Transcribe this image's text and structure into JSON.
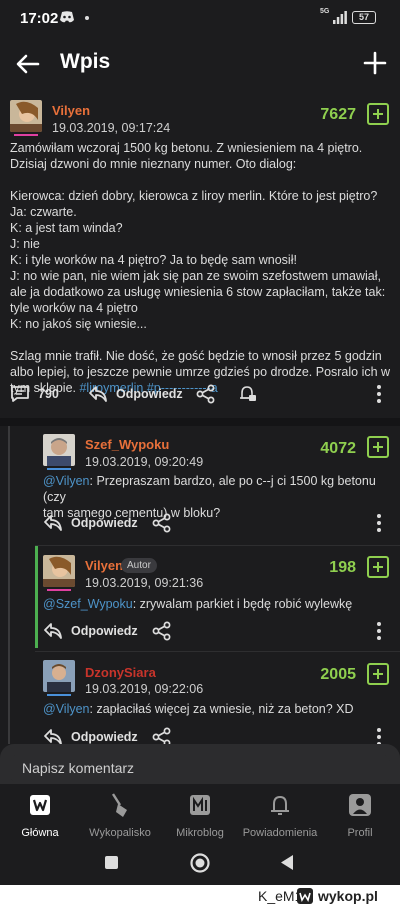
{
  "status_bar": {
    "time": "17:02",
    "network": "5G",
    "battery": "57"
  },
  "app_bar": {
    "title": "Wpis",
    "back_icon": "arrow-left-icon",
    "add_icon": "plus-icon"
  },
  "post": {
    "author": "Vilyen",
    "author_color": "#e8703a",
    "date": "19.03.2019, 09:17:24",
    "votes": "7627",
    "lines": [
      "Zamówiłam wczoraj 1500 kg betonu. Z wniesieniem na 4 piętro.",
      "Dzisiaj dzwoni do mnie nieznany numer. Oto dialog:",
      "",
      "Kierowca: dzień dobry, kierowca z liroy merlin. Które to jest piętro?",
      "Ja: czwarte.",
      "K: a jest tam winda?",
      "J: nie",
      "K: i tyle worków na 4 piętro? Ja to będę sam wnosił!",
      "J: no wie pan, nie wiem jak się pan ze swoim szefostwem umawiał,",
      "ale ja dodatkowo za usługę wniesienia 6 stow zapłaciłam, także tak:",
      "tyle worków na 4 piętro",
      "K: no jakoś się wniesie...",
      "",
      "Szlag mnie trafił. Nie dość, że gość będzie to wnosił przez 5 godzin",
      "albo lepiej, to jeszcze pewnie umrze gdzieś po drodze. Posralo ich w",
      "tym sklepie. "
    ],
    "tag1": "#liroymerlin",
    "tag2": "#p------------a",
    "comments_count": "790",
    "reply_label": "Odpowiedz"
  },
  "comments": [
    {
      "author": "Szef_Wypoku",
      "author_color": "#e8703a",
      "date": "19.03.2019, 09:20:49",
      "votes": "4072",
      "mention": "@Vilyen",
      "text_line1": ": Przepraszam bardzo, ale po c--j ci 1500 kg betonu (czy",
      "text_line2": "tam samego cementu) w bloku?",
      "reply_label": "Odpowiedz"
    },
    {
      "author": "Vilyen",
      "author_color": "#e8703a",
      "badge": "Autor",
      "date": "19.03.2019, 09:21:36",
      "votes": "198",
      "mention": "@Szef_Wypoku",
      "text_line1": ": zrywalam parkiet i będę robić wylewkę",
      "reply_label": "Odpowiedz"
    },
    {
      "author": "DzonySiara",
      "author_color": "#c8342b",
      "date": "19.03.2019, 09:22:06",
      "votes": "2005",
      "mention": "@Vilyen",
      "text_line1": ": zapłaciłaś więcej za wniesie, niż za beton? XD",
      "reply_label": "Odpowiedz"
    }
  ],
  "composer": {
    "placeholder": "Napisz komentarz"
  },
  "bottom_nav": [
    {
      "label": "Główna",
      "icon": "home-logo-icon"
    },
    {
      "label": "Wykopalisko",
      "icon": "shovel-icon"
    },
    {
      "label": "Mikroblog",
      "icon": "mikroblog-icon"
    },
    {
      "label": "Powiadomienia",
      "icon": "bell-icon"
    },
    {
      "label": "Profil",
      "icon": "profile-icon"
    }
  ],
  "watermark": {
    "user": "K_eM1",
    "separator": "z",
    "site": "wykop.pl"
  }
}
